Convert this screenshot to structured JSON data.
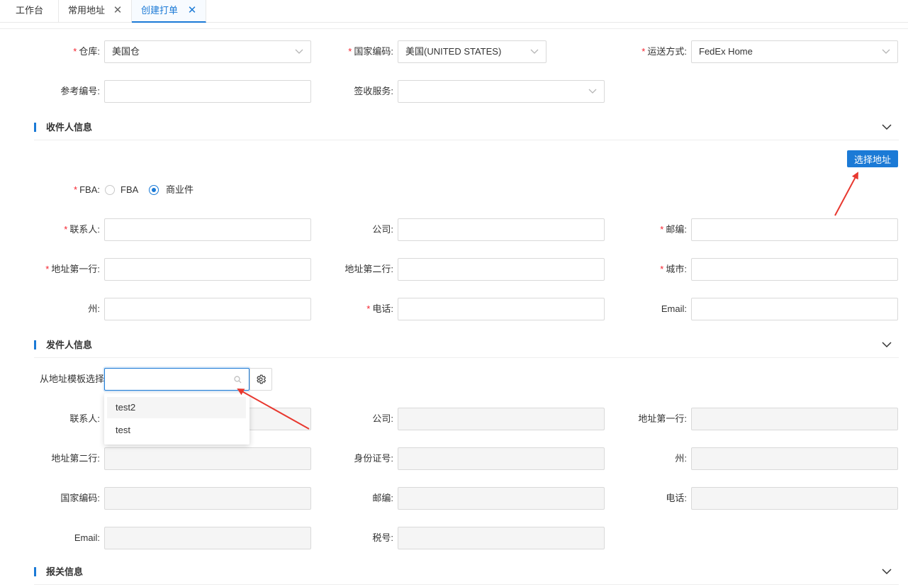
{
  "tabs": [
    {
      "label": "工作台",
      "closable": false,
      "active": false
    },
    {
      "label": "常用地址",
      "closable": true,
      "active": false
    },
    {
      "label": "创建打单",
      "closable": true,
      "active": true
    }
  ],
  "shipping": {
    "warehouse": {
      "label": "仓库",
      "required": true,
      "value": "美国仓"
    },
    "country_code": {
      "label": "国家编码",
      "required": true,
      "value": "美国(UNITED STATES)"
    },
    "shipping_method": {
      "label": "运送方式",
      "required": true,
      "value": "FedEx Home"
    },
    "reference_no": {
      "label": "参考编号",
      "value": ""
    },
    "signature_service": {
      "label": "签收服务",
      "value": ""
    }
  },
  "recipient": {
    "section_title": "收件人信息",
    "select_address_button": "选择地址",
    "fba": {
      "label": "FBA",
      "required": true,
      "options": [
        "FBA",
        "商业件"
      ],
      "selected": "商业件"
    },
    "contact": {
      "label": "联系人",
      "required": true,
      "value": ""
    },
    "company": {
      "label": "公司",
      "value": ""
    },
    "postcode": {
      "label": "邮编",
      "required": true,
      "value": ""
    },
    "address1": {
      "label": "地址第一行",
      "required": true,
      "value": ""
    },
    "address2": {
      "label": "地址第二行",
      "value": ""
    },
    "city": {
      "label": "城市",
      "required": true,
      "value": ""
    },
    "state": {
      "label": "州",
      "value": ""
    },
    "phone": {
      "label": "电话",
      "required": true,
      "value": ""
    },
    "email": {
      "label": "Email",
      "value": ""
    }
  },
  "sender": {
    "section_title": "发件人信息",
    "template_select": {
      "label": "从地址模板选择",
      "value": "",
      "icon": "search-icon",
      "dropdown_options": [
        "test2",
        "test"
      ],
      "hovered": "test2"
    },
    "settings_icon": "gear-icon",
    "contact": {
      "label": "联系人",
      "value": ""
    },
    "company": {
      "label": "公司",
      "value": ""
    },
    "address1": {
      "label": "地址第一行",
      "value": ""
    },
    "address2": {
      "label": "地址第二行",
      "value": ""
    },
    "id_number": {
      "label": "身份证号",
      "value": ""
    },
    "state": {
      "label": "州",
      "value": ""
    },
    "country_code": {
      "label": "国家编码",
      "value": ""
    },
    "postcode": {
      "label": "邮编",
      "value": ""
    },
    "phone": {
      "label": "电话",
      "value": ""
    },
    "email": {
      "label": "Email",
      "value": ""
    },
    "tax_no": {
      "label": "税号",
      "value": ""
    }
  },
  "customs": {
    "section_title": "报关信息"
  },
  "colors": {
    "accent": "#1b7ad6",
    "required": "#f5222d",
    "annotation_arrow": "#e8382f"
  }
}
